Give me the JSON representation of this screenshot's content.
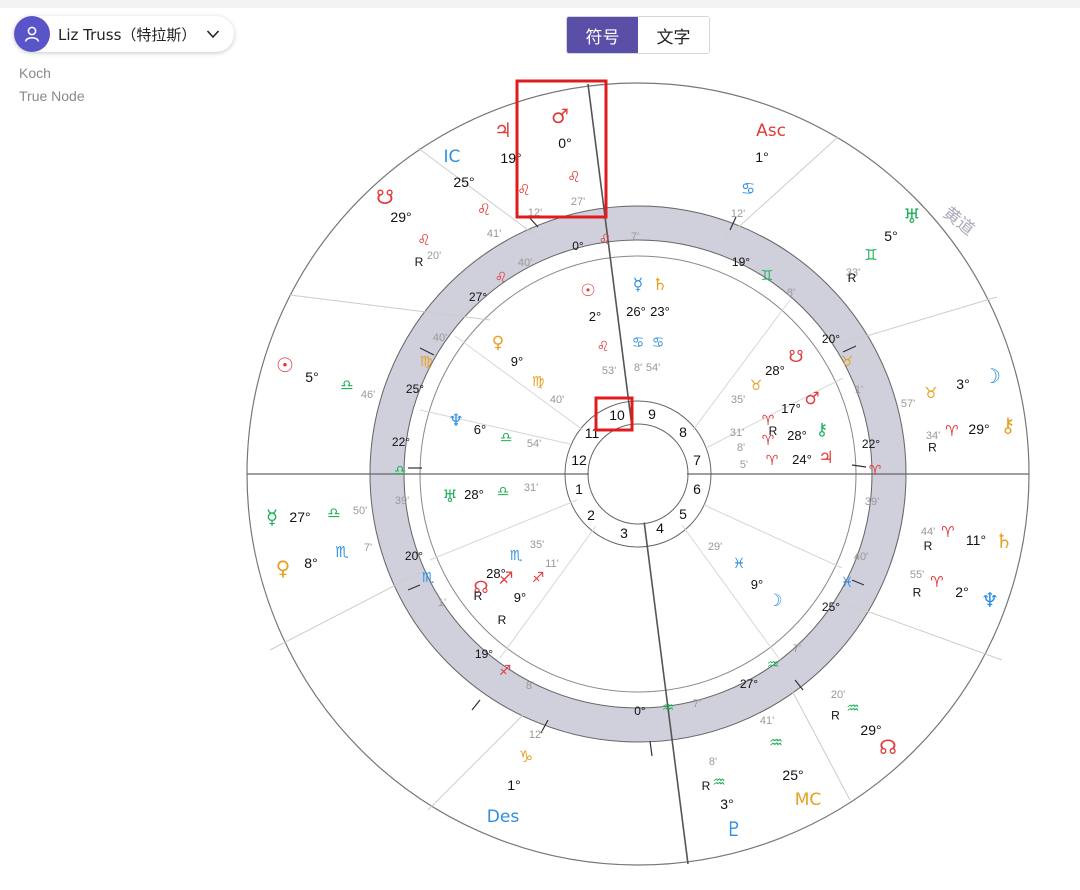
{
  "header": {
    "person_name": "Liz Truss（特拉斯）",
    "house_system": "Koch",
    "node_type": "True Node"
  },
  "toggle": {
    "symbols_label": "符号",
    "text_label": "文字",
    "active": "symbols"
  },
  "chart": {
    "ecliptic_label": "黄道",
    "house_numbers": [
      "1",
      "2",
      "3",
      "4",
      "5",
      "6",
      "7",
      "8",
      "9",
      "10",
      "11",
      "12"
    ],
    "highlighted_house": "10",
    "colors": {
      "fire": "#e03a3a",
      "earth": "#e8a020",
      "air": "#22b05a",
      "water": "#2e8fe0",
      "accent": "#5a4fa6",
      "highlight": "#e01b1b"
    },
    "angles": [
      {
        "name": "Asc",
        "deg": "1°",
        "sign": "♋",
        "min": "12'"
      },
      {
        "name": "MC",
        "deg": "25°",
        "sign": "♒",
        "min": "41'"
      },
      {
        "name": "Des",
        "deg": "1°",
        "sign": "♑",
        "min": "12'"
      },
      {
        "name": "IC",
        "deg": "25°",
        "sign": "♌",
        "min": "41'"
      }
    ],
    "outer_bodies": [
      {
        "glyph": "♂",
        "deg": "0°",
        "sign": "♌",
        "min": "27'"
      },
      {
        "glyph": "♃",
        "deg": "19°",
        "sign": "♌",
        "min": "12'"
      },
      {
        "glyph": "☋",
        "deg": "29°",
        "sign": "♌",
        "min": "20'",
        "retro": "R"
      },
      {
        "glyph": "☉",
        "deg": "5°",
        "sign": "♎",
        "min": "46'"
      },
      {
        "glyph": "☿",
        "deg": "27°",
        "sign": "♎",
        "min": "50'"
      },
      {
        "glyph": "♀",
        "deg": "8°",
        "sign": "♏",
        "min": "7'"
      },
      {
        "glyph": "♅",
        "deg": "5°",
        "sign": "♊",
        "min": "33'",
        "retro": "R"
      },
      {
        "glyph": "☽",
        "deg": "3°",
        "sign": "♉",
        "min": "57'"
      },
      {
        "glyph": "⚷",
        "deg": "29°",
        "sign": "♈",
        "min": "34'",
        "retro": "R"
      },
      {
        "glyph": "♄",
        "deg": "11°",
        "sign": "♈",
        "min": "44'",
        "retro": "R"
      },
      {
        "glyph": "♆",
        "deg": "2°",
        "sign": "♈",
        "min": "55'",
        "retro": "R"
      },
      {
        "glyph": "☊",
        "deg": "29°",
        "sign": "♒",
        "min": "20'",
        "retro": "R"
      },
      {
        "glyph": "♇",
        "deg": "3°",
        "sign": "♒",
        "min": "8'",
        "retro": "R"
      }
    ],
    "inner_bodies": [
      {
        "glyph": "☉",
        "deg": "2°",
        "sign": "♌",
        "min": "53'"
      },
      {
        "glyph": "☿",
        "deg": "26°",
        "sign": "♋",
        "min": "8'"
      },
      {
        "glyph": "♄",
        "deg": "23°",
        "sign": "♋",
        "min": "54'"
      },
      {
        "glyph": "♀",
        "deg": "9°",
        "sign": "♍",
        "min": "40'"
      },
      {
        "glyph": "♆",
        "deg": "6°",
        "sign": "♎",
        "min": "54'"
      },
      {
        "glyph": "♅",
        "deg": "28°",
        "sign": "♎",
        "min": "31'"
      },
      {
        "glyph": "☋",
        "deg": "28°",
        "sign": "♉",
        "min": "35'"
      },
      {
        "glyph": "♂",
        "deg": "17°",
        "sign": "♈",
        "min": "31'",
        "retro": "R"
      },
      {
        "glyph": "⚷",
        "deg": "28°",
        "sign": "♈",
        "min": "8'"
      },
      {
        "glyph": "♃",
        "deg": "24°",
        "sign": "♈",
        "min": "5'"
      },
      {
        "glyph": "☽",
        "deg": "9°",
        "sign": "♓",
        "min": "29'"
      },
      {
        "glyph": "☊",
        "deg": "28°",
        "sign": "♏",
        "min": "35'",
        "retro": "R"
      },
      {
        "glyph": "♐",
        "deg": "9°",
        "sign": "♐",
        "min": "11'",
        "retro": "R"
      }
    ],
    "ring_cusps": [
      {
        "deg": "0°",
        "sign": "♌",
        "min": "7'"
      },
      {
        "deg": "19°",
        "sign": "♊",
        "min": "8'"
      },
      {
        "deg": "20°",
        "sign": "♉",
        "min": "1'"
      },
      {
        "deg": "22°",
        "sign": "♈",
        "min": "39'"
      },
      {
        "deg": "25°",
        "sign": "♓",
        "min": "40'"
      },
      {
        "deg": "27°",
        "sign": "♒",
        "min": "7'"
      },
      {
        "deg": "0°",
        "sign": "♒",
        "min": "7'"
      },
      {
        "deg": "19°",
        "sign": "♐",
        "min": "8'"
      },
      {
        "deg": "20°",
        "sign": "♏",
        "min": "1'"
      },
      {
        "deg": "22°",
        "sign": "♎",
        "min": "39'"
      },
      {
        "deg": "25°",
        "sign": "♍",
        "min": "40'"
      },
      {
        "deg": "27°",
        "sign": "♌",
        "min": "40'"
      }
    ]
  }
}
